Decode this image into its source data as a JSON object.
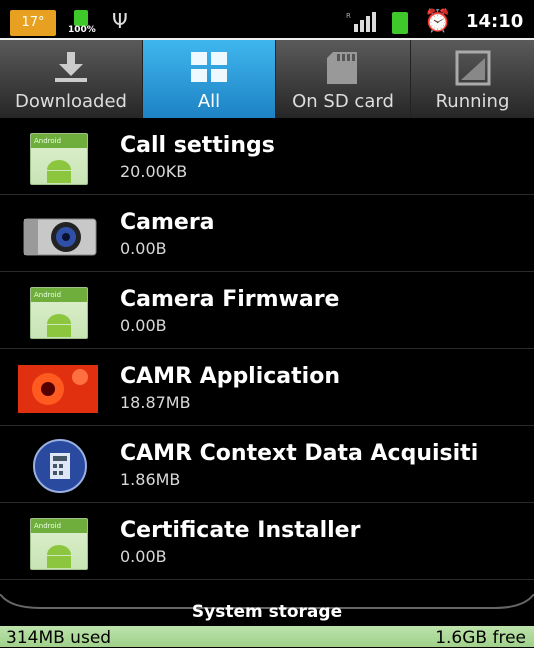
{
  "status_bar": {
    "temperature": "17°",
    "battery_percent": "100%",
    "time": "14:10",
    "icons": [
      "battery-icon",
      "usb-icon",
      "signal-icon",
      "alarm-icon"
    ]
  },
  "tabs": [
    {
      "label": "Downloaded",
      "icon": "download-icon"
    },
    {
      "label": "All",
      "icon": "grid-icon",
      "selected": true
    },
    {
      "label": "On SD card",
      "icon": "sd-card-icon"
    },
    {
      "label": "Running",
      "icon": "running-icon"
    }
  ],
  "apps": [
    {
      "name": "Call settings",
      "size": "20.00KB",
      "icon": "android-icon"
    },
    {
      "name": "Camera",
      "size": "0.00B",
      "icon": "camera-icon"
    },
    {
      "name": "Camera Firmware",
      "size": "0.00B",
      "icon": "android-icon"
    },
    {
      "name": "CAMR Application",
      "size": "18.87MB",
      "icon": "flower-icon"
    },
    {
      "name": "CAMR Context Data Acquisiti",
      "size": "1.86MB",
      "icon": "calculator-icon"
    },
    {
      "name": "Certificate Installer",
      "size": "0.00B",
      "icon": "android-icon"
    }
  ],
  "storage": {
    "title": "System storage",
    "used": "314MB used",
    "free": "1.6GB free"
  },
  "colors": {
    "tab_selected": "#2a9be0",
    "storage_bar": "#b3dea0",
    "temp_badge": "#e8a020"
  }
}
